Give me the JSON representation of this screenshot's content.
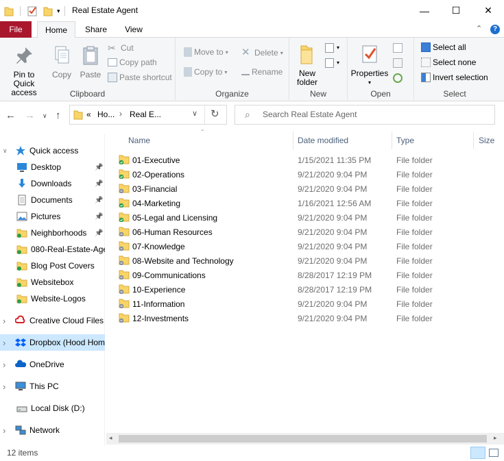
{
  "window": {
    "title": "Real Estate Agent"
  },
  "tabs": {
    "file": "File",
    "home": "Home",
    "share": "Share",
    "view": "View"
  },
  "ribbon": {
    "clipboard": {
      "label": "Clipboard",
      "pin": "Pin to Quick access",
      "copy": "Copy",
      "paste": "Paste",
      "cut": "Cut",
      "copy_path": "Copy path",
      "paste_shortcut": "Paste shortcut"
    },
    "organize": {
      "label": "Organize",
      "move_to": "Move to",
      "copy_to": "Copy to",
      "delete": "Delete",
      "rename": "Rename"
    },
    "new": {
      "label": "New",
      "new_folder": "New folder"
    },
    "open": {
      "label": "Open",
      "properties": "Properties"
    },
    "select": {
      "label": "Select",
      "select_all": "Select all",
      "select_none": "Select none",
      "invert": "Invert selection"
    }
  },
  "address": {
    "overflow": "«",
    "crumb1": "Ho...",
    "crumb2": "Real E...",
    "search_placeholder": "Search Real Estate Agent"
  },
  "nav": [
    {
      "label": "Quick access",
      "icon": "star-icon"
    },
    {
      "label": "Desktop",
      "icon": "desktop-icon"
    },
    {
      "label": "Downloads",
      "icon": "download-icon"
    },
    {
      "label": "Documents",
      "icon": "documents-icon"
    },
    {
      "label": "Pictures",
      "icon": "pictures-icon"
    },
    {
      "label": "Neighborhoods",
      "icon": "folder-icon"
    },
    {
      "label": "080-Real-Estate-Age",
      "icon": "folder-icon"
    },
    {
      "label": "Blog Post Covers",
      "icon": "folder-icon"
    },
    {
      "label": "Websitebox",
      "icon": "folder-icon"
    },
    {
      "label": "Website-Logos",
      "icon": "folder-icon"
    },
    {
      "label": "Creative Cloud Files",
      "icon": "creative-cloud-icon"
    },
    {
      "label": "Dropbox (Hood Hom",
      "icon": "dropbox-icon"
    },
    {
      "label": "OneDrive",
      "icon": "onedrive-icon"
    },
    {
      "label": "This PC",
      "icon": "pc-icon"
    },
    {
      "label": "Local Disk (D:)",
      "icon": "disk-icon"
    },
    {
      "label": "Network",
      "icon": "network-icon"
    }
  ],
  "columns": {
    "name": "Name",
    "date": "Date modified",
    "type": "Type",
    "size": "Size"
  },
  "files": [
    {
      "name": "01-Executive",
      "date": "1/15/2021 11:35 PM",
      "type": "File folder",
      "sync": "synced"
    },
    {
      "name": "02-Operations",
      "date": "9/21/2020 9:04 PM",
      "type": "File folder",
      "sync": "synced"
    },
    {
      "name": "03-Financial",
      "date": "9/21/2020 9:04 PM",
      "type": "File folder",
      "sync": "pending"
    },
    {
      "name": "04-Marketing",
      "date": "1/16/2021 12:56 AM",
      "type": "File folder",
      "sync": "synced"
    },
    {
      "name": "05-Legal and Licensing",
      "date": "9/21/2020 9:04 PM",
      "type": "File folder",
      "sync": "synced"
    },
    {
      "name": "06-Human Resources",
      "date": "9/21/2020 9:04 PM",
      "type": "File folder",
      "sync": "pending"
    },
    {
      "name": "07-Knowledge",
      "date": "9/21/2020 9:04 PM",
      "type": "File folder",
      "sync": "pending"
    },
    {
      "name": "08-Website and Technology",
      "date": "9/21/2020 9:04 PM",
      "type": "File folder",
      "sync": "pending"
    },
    {
      "name": "09-Communications",
      "date": "8/28/2017 12:19 PM",
      "type": "File folder",
      "sync": "pending"
    },
    {
      "name": "10-Experience",
      "date": "8/28/2017 12:19 PM",
      "type": "File folder",
      "sync": "pending"
    },
    {
      "name": "11-Information",
      "date": "9/21/2020 9:04 PM",
      "type": "File folder",
      "sync": "pending"
    },
    {
      "name": "12-Investments",
      "date": "9/21/2020 9:04 PM",
      "type": "File folder",
      "sync": "pending"
    }
  ],
  "status": {
    "count": "12 items"
  }
}
